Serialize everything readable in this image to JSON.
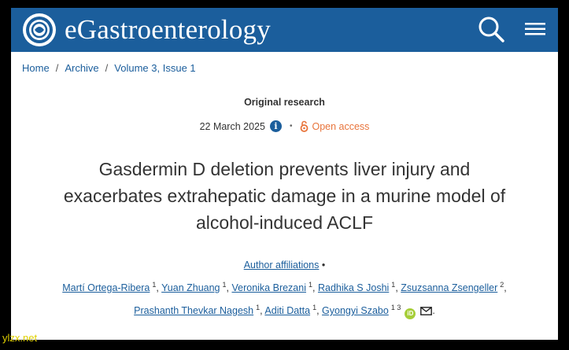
{
  "header": {
    "brand": "eGastroenterology",
    "search_icon": "search-icon",
    "menu_icon": "hamburger-menu-icon",
    "background": "#1b5e9c"
  },
  "breadcrumb": {
    "items": [
      "Home",
      "Archive",
      "Volume 3, Issue 1"
    ],
    "separator": "/"
  },
  "article": {
    "type": "Original research",
    "date": "22 March 2025",
    "access": "Open access",
    "title_lines": [
      "Gasdermin D deletion prevents liver injury and",
      "exacerbates extrahepatic damage in a murine model of",
      "alcohol-induced ACLF"
    ]
  },
  "affiliations_link": "Author affiliations",
  "bullet": "•",
  "authors_row1": [
    {
      "name": "Martí Ortega-Ribera",
      "sup": "1"
    },
    {
      "name": "Yuan Zhuang",
      "sup": "1"
    },
    {
      "name": "Veronika Brezani",
      "sup": "1"
    },
    {
      "name": "Radhika S Joshi",
      "sup": "1"
    },
    {
      "name": "Zsuzsanna Zsengeller",
      "sup": "2"
    }
  ],
  "authors_row2": [
    {
      "name": "Prashanth Thevkar Nagesh",
      "sup": "1"
    },
    {
      "name": "Aditi Datta",
      "sup": "1"
    },
    {
      "name": "Gyongyi Szabo",
      "sup": "1 3"
    }
  ],
  "orcid_label": "iD",
  "watermark": "ylzx.net"
}
